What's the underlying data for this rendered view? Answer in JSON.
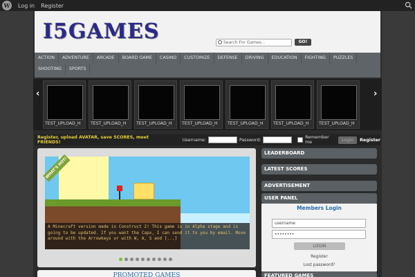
{
  "admin_bar": {
    "wp_logo": "W",
    "login": "Log in",
    "register": "Register",
    "search_icon": "search-icon"
  },
  "header": {
    "logo": "I5GAMES",
    "search_placeholder": "Search For Games...",
    "go_label": "GO!"
  },
  "nav": {
    "categories": [
      "ACTION",
      "ADVENTURE",
      "ARCADE",
      "BOARD GAME",
      "CASINO",
      "CUSTOMIZE",
      "DEFENSE",
      "DRIVING",
      "EDUCATION",
      "FIGHTING",
      "PUZZLES",
      "SHOOTING",
      "SPORTS"
    ]
  },
  "carousel": {
    "prev": "‹",
    "next": "›",
    "items": [
      "TEST_UPLOAD_H",
      "TEST_UPLOAD_H",
      "TEST_UPLOAD_H",
      "TEST_UPLOAD_H",
      "TEST_UPLOAD_H",
      "TEST_UPLOAD_H",
      "TEST_UPLOAD_H"
    ]
  },
  "login_strip": {
    "promo": "Register, upload AVATAR, save SCORES, meet FRIENDS!",
    "username_label": "Username:",
    "password_label": "Password:",
    "remember_label": "Remember me",
    "login_button": "Login",
    "register_link": "Register"
  },
  "feature": {
    "badge": "WHAT'S HOT!",
    "caption": "A Minecraft version made in Construct 2! This game is in Alpha stage and is going to be updated. If you want the Capx, I can send it to you by email. Move around with the Arrowkeys or with W, A, S and [...]",
    "dot_count": 10,
    "active_dot": 0
  },
  "promoted": {
    "title": "PROMOTED GAMES"
  },
  "sidebar": {
    "leaderboard": "LEADERBOARD",
    "latest_scores": "LATEST SCORES",
    "advertisement": "ADVERTISEMENT",
    "user_panel": "USER PANEL",
    "members_login": "Members Login",
    "username_value": "username",
    "password_value": "••••••••",
    "login_button": "LOGIN",
    "register_link": "Register",
    "lost_password": "Lost password?",
    "featured_games": "FEATURED GAMES"
  },
  "colors": {
    "accent_blue": "#2a6dad",
    "promo_yellow": "#e8d23b",
    "hot_green": "#7fa43a"
  }
}
